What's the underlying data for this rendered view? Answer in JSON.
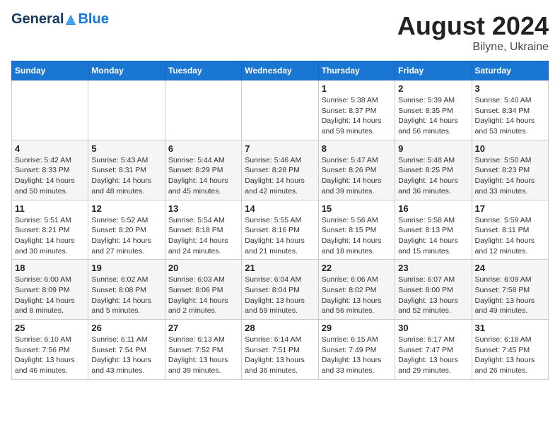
{
  "header": {
    "logo_general": "General",
    "logo_blue": "Blue",
    "title": "August 2024",
    "subtitle": "Bilyne, Ukraine"
  },
  "weekdays": [
    "Sunday",
    "Monday",
    "Tuesday",
    "Wednesday",
    "Thursday",
    "Friday",
    "Saturday"
  ],
  "weeks": [
    [
      {
        "day": "",
        "info": ""
      },
      {
        "day": "",
        "info": ""
      },
      {
        "day": "",
        "info": ""
      },
      {
        "day": "",
        "info": ""
      },
      {
        "day": "1",
        "info": "Sunrise: 5:38 AM\nSunset: 8:37 PM\nDaylight: 14 hours\nand 59 minutes."
      },
      {
        "day": "2",
        "info": "Sunrise: 5:39 AM\nSunset: 8:35 PM\nDaylight: 14 hours\nand 56 minutes."
      },
      {
        "day": "3",
        "info": "Sunrise: 5:40 AM\nSunset: 8:34 PM\nDaylight: 14 hours\nand 53 minutes."
      }
    ],
    [
      {
        "day": "4",
        "info": "Sunrise: 5:42 AM\nSunset: 8:33 PM\nDaylight: 14 hours\nand 50 minutes."
      },
      {
        "day": "5",
        "info": "Sunrise: 5:43 AM\nSunset: 8:31 PM\nDaylight: 14 hours\nand 48 minutes."
      },
      {
        "day": "6",
        "info": "Sunrise: 5:44 AM\nSunset: 8:29 PM\nDaylight: 14 hours\nand 45 minutes."
      },
      {
        "day": "7",
        "info": "Sunrise: 5:46 AM\nSunset: 8:28 PM\nDaylight: 14 hours\nand 42 minutes."
      },
      {
        "day": "8",
        "info": "Sunrise: 5:47 AM\nSunset: 8:26 PM\nDaylight: 14 hours\nand 39 minutes."
      },
      {
        "day": "9",
        "info": "Sunrise: 5:48 AM\nSunset: 8:25 PM\nDaylight: 14 hours\nand 36 minutes."
      },
      {
        "day": "10",
        "info": "Sunrise: 5:50 AM\nSunset: 8:23 PM\nDaylight: 14 hours\nand 33 minutes."
      }
    ],
    [
      {
        "day": "11",
        "info": "Sunrise: 5:51 AM\nSunset: 8:21 PM\nDaylight: 14 hours\nand 30 minutes."
      },
      {
        "day": "12",
        "info": "Sunrise: 5:52 AM\nSunset: 8:20 PM\nDaylight: 14 hours\nand 27 minutes."
      },
      {
        "day": "13",
        "info": "Sunrise: 5:54 AM\nSunset: 8:18 PM\nDaylight: 14 hours\nand 24 minutes."
      },
      {
        "day": "14",
        "info": "Sunrise: 5:55 AM\nSunset: 8:16 PM\nDaylight: 14 hours\nand 21 minutes."
      },
      {
        "day": "15",
        "info": "Sunrise: 5:56 AM\nSunset: 8:15 PM\nDaylight: 14 hours\nand 18 minutes."
      },
      {
        "day": "16",
        "info": "Sunrise: 5:58 AM\nSunset: 8:13 PM\nDaylight: 14 hours\nand 15 minutes."
      },
      {
        "day": "17",
        "info": "Sunrise: 5:59 AM\nSunset: 8:11 PM\nDaylight: 14 hours\nand 12 minutes."
      }
    ],
    [
      {
        "day": "18",
        "info": "Sunrise: 6:00 AM\nSunset: 8:09 PM\nDaylight: 14 hours\nand 8 minutes."
      },
      {
        "day": "19",
        "info": "Sunrise: 6:02 AM\nSunset: 8:08 PM\nDaylight: 14 hours\nand 5 minutes."
      },
      {
        "day": "20",
        "info": "Sunrise: 6:03 AM\nSunset: 8:06 PM\nDaylight: 14 hours\nand 2 minutes."
      },
      {
        "day": "21",
        "info": "Sunrise: 6:04 AM\nSunset: 8:04 PM\nDaylight: 13 hours\nand 59 minutes."
      },
      {
        "day": "22",
        "info": "Sunrise: 6:06 AM\nSunset: 8:02 PM\nDaylight: 13 hours\nand 56 minutes."
      },
      {
        "day": "23",
        "info": "Sunrise: 6:07 AM\nSunset: 8:00 PM\nDaylight: 13 hours\nand 52 minutes."
      },
      {
        "day": "24",
        "info": "Sunrise: 6:09 AM\nSunset: 7:58 PM\nDaylight: 13 hours\nand 49 minutes."
      }
    ],
    [
      {
        "day": "25",
        "info": "Sunrise: 6:10 AM\nSunset: 7:56 PM\nDaylight: 13 hours\nand 46 minutes."
      },
      {
        "day": "26",
        "info": "Sunrise: 6:11 AM\nSunset: 7:54 PM\nDaylight: 13 hours\nand 43 minutes."
      },
      {
        "day": "27",
        "info": "Sunrise: 6:13 AM\nSunset: 7:52 PM\nDaylight: 13 hours\nand 39 minutes."
      },
      {
        "day": "28",
        "info": "Sunrise: 6:14 AM\nSunset: 7:51 PM\nDaylight: 13 hours\nand 36 minutes."
      },
      {
        "day": "29",
        "info": "Sunrise: 6:15 AM\nSunset: 7:49 PM\nDaylight: 13 hours\nand 33 minutes."
      },
      {
        "day": "30",
        "info": "Sunrise: 6:17 AM\nSunset: 7:47 PM\nDaylight: 13 hours\nand 29 minutes."
      },
      {
        "day": "31",
        "info": "Sunrise: 6:18 AM\nSunset: 7:45 PM\nDaylight: 13 hours\nand 26 minutes."
      }
    ]
  ]
}
